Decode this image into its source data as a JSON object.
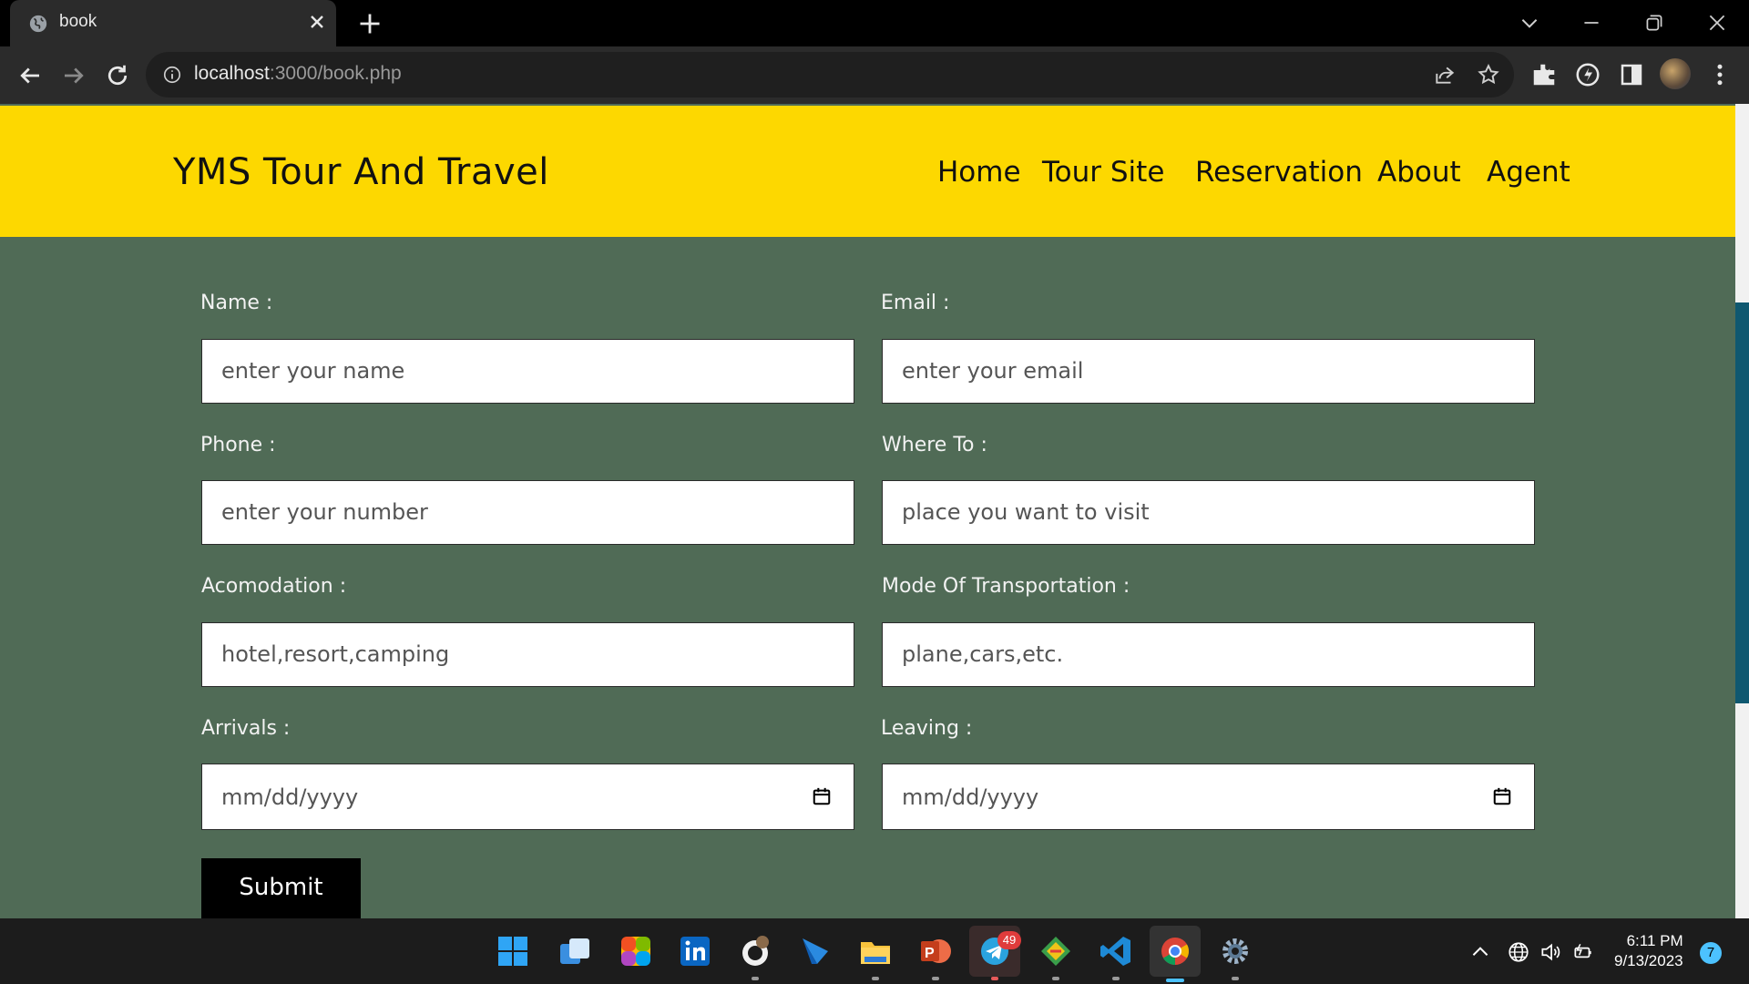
{
  "browser": {
    "tab_title": "book",
    "url_host": "localhost",
    "url_path": ":3000/book.php"
  },
  "site": {
    "brand": "YMS Tour And Travel",
    "nav": [
      "Home",
      "Tour Site",
      "Reservation",
      "About",
      "Agent"
    ],
    "header_color": "#fdd800",
    "background_color": "#506b56"
  },
  "form": {
    "name_label": "Name :",
    "name_placeholder": "enter your name",
    "email_label": "Email :",
    "email_placeholder": "enter your email",
    "phone_label": "Phone :",
    "phone_placeholder": "enter your number",
    "where_label": "Where To :",
    "where_placeholder": "place you want to visit",
    "accommodation_label": "Acomodation :",
    "accommodation_placeholder": "hotel,resort,camping",
    "transport_label": "Mode Of Transportation :",
    "transport_placeholder": "plane,cars,etc.",
    "arrivals_label": "Arrivals :",
    "arrivals_placeholder": "mm/dd/yyyy",
    "leaving_label": "Leaving :",
    "leaving_placeholder": "mm/dd/yyyy",
    "submit_label": "Submit"
  },
  "taskbar": {
    "telegram_badge": "49",
    "time": "6:11 PM",
    "date": "9/13/2023",
    "notification_count": "7"
  }
}
